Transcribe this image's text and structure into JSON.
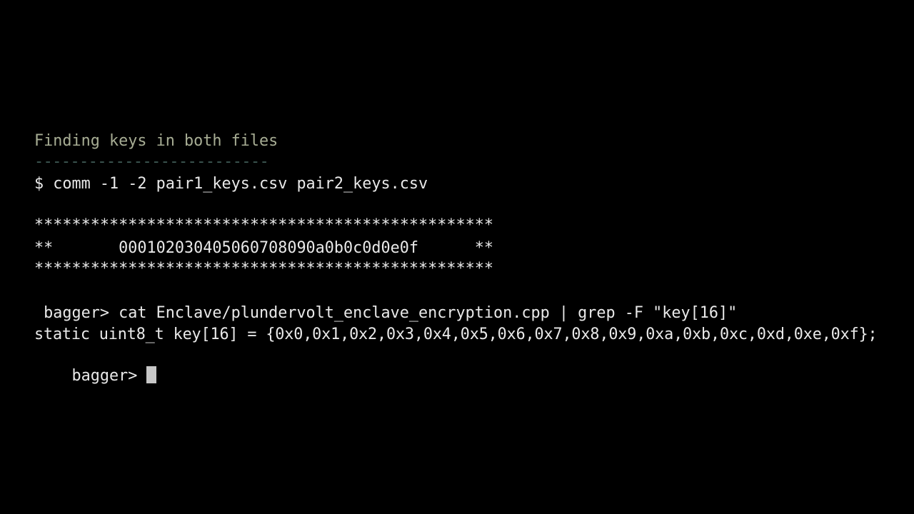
{
  "terminal": {
    "heading": "Finding keys in both files",
    "rule": "--------------------------",
    "command1": "$ comm -1 -2 pair1_keys.csv pair2_keys.csv",
    "box_top": "*************************************************",
    "box_middle": "**       000102030405060708090a0b0c0d0e0f      **",
    "box_bottom": "*************************************************",
    "command2": " bagger> cat Enclave/plundervolt_enclave_encryption.cpp | grep -F \"key[16]\"",
    "output_line": "static uint8_t key[16] = {0x0,0x1,0x2,0x3,0x4,0x5,0x6,0x7,0x8,0x9,0xa,0xb,0xc,0xd,0xe,0xf};",
    "prompt": "bagger> "
  },
  "colors": {
    "background": "#000000",
    "text": "#e9e9e9",
    "heading": "#a7ad94",
    "rule": "#3f5a55",
    "cursor": "#c7c7c7"
  }
}
